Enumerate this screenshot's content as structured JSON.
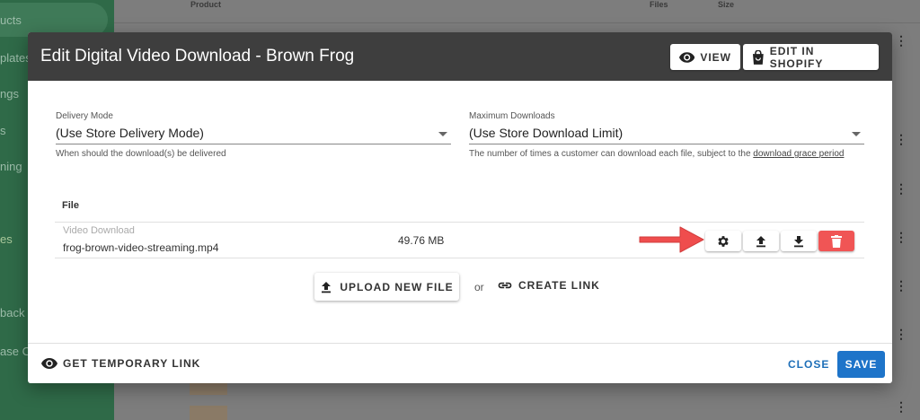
{
  "background": {
    "sidebar_items": [
      "ucts",
      "plates",
      "ngs",
      "s",
      "ning",
      "es",
      "back",
      "ase C"
    ],
    "table_headers": {
      "product": "Product",
      "files": "Files",
      "size": "Size"
    }
  },
  "modal": {
    "title": "Edit Digital Video Download - Brown Frog",
    "view_label": "VIEW",
    "edit_shopify_label": "EDIT IN SHOPIFY",
    "delivery": {
      "label": "Delivery Mode",
      "value": "(Use Store Delivery Mode)",
      "help": "When should the download(s) be delivered"
    },
    "max_downloads": {
      "label": "Maximum Downloads",
      "value": "(Use Store Download Limit)",
      "help_prefix": "The number of times a customer can download each file, subject to the ",
      "help_link": "download grace period"
    },
    "file_header": "File",
    "file": {
      "type": "Video Download",
      "name": "frog-brown-video-streaming.mp4",
      "size": "49.76 MB"
    },
    "upload_label": "UPLOAD NEW FILE",
    "or_text": "or",
    "create_link_label": "CREATE LINK",
    "temp_link_label": "GET TEMPORARY LINK",
    "close_label": "CLOSE",
    "save_label": "SAVE"
  },
  "colors": {
    "header_bg": "#3e3e3e",
    "primary": "#1e74c9",
    "delete": "#f05555",
    "arrow": "#ef4d4d",
    "sidebar": "#2f6a48"
  },
  "icons": [
    "eye-icon",
    "shopping-bag-icon",
    "gear-icon",
    "upload-icon",
    "download-icon",
    "trash-icon",
    "link-icon",
    "kebab-menu-icon",
    "arrow-pointer-icon"
  ]
}
